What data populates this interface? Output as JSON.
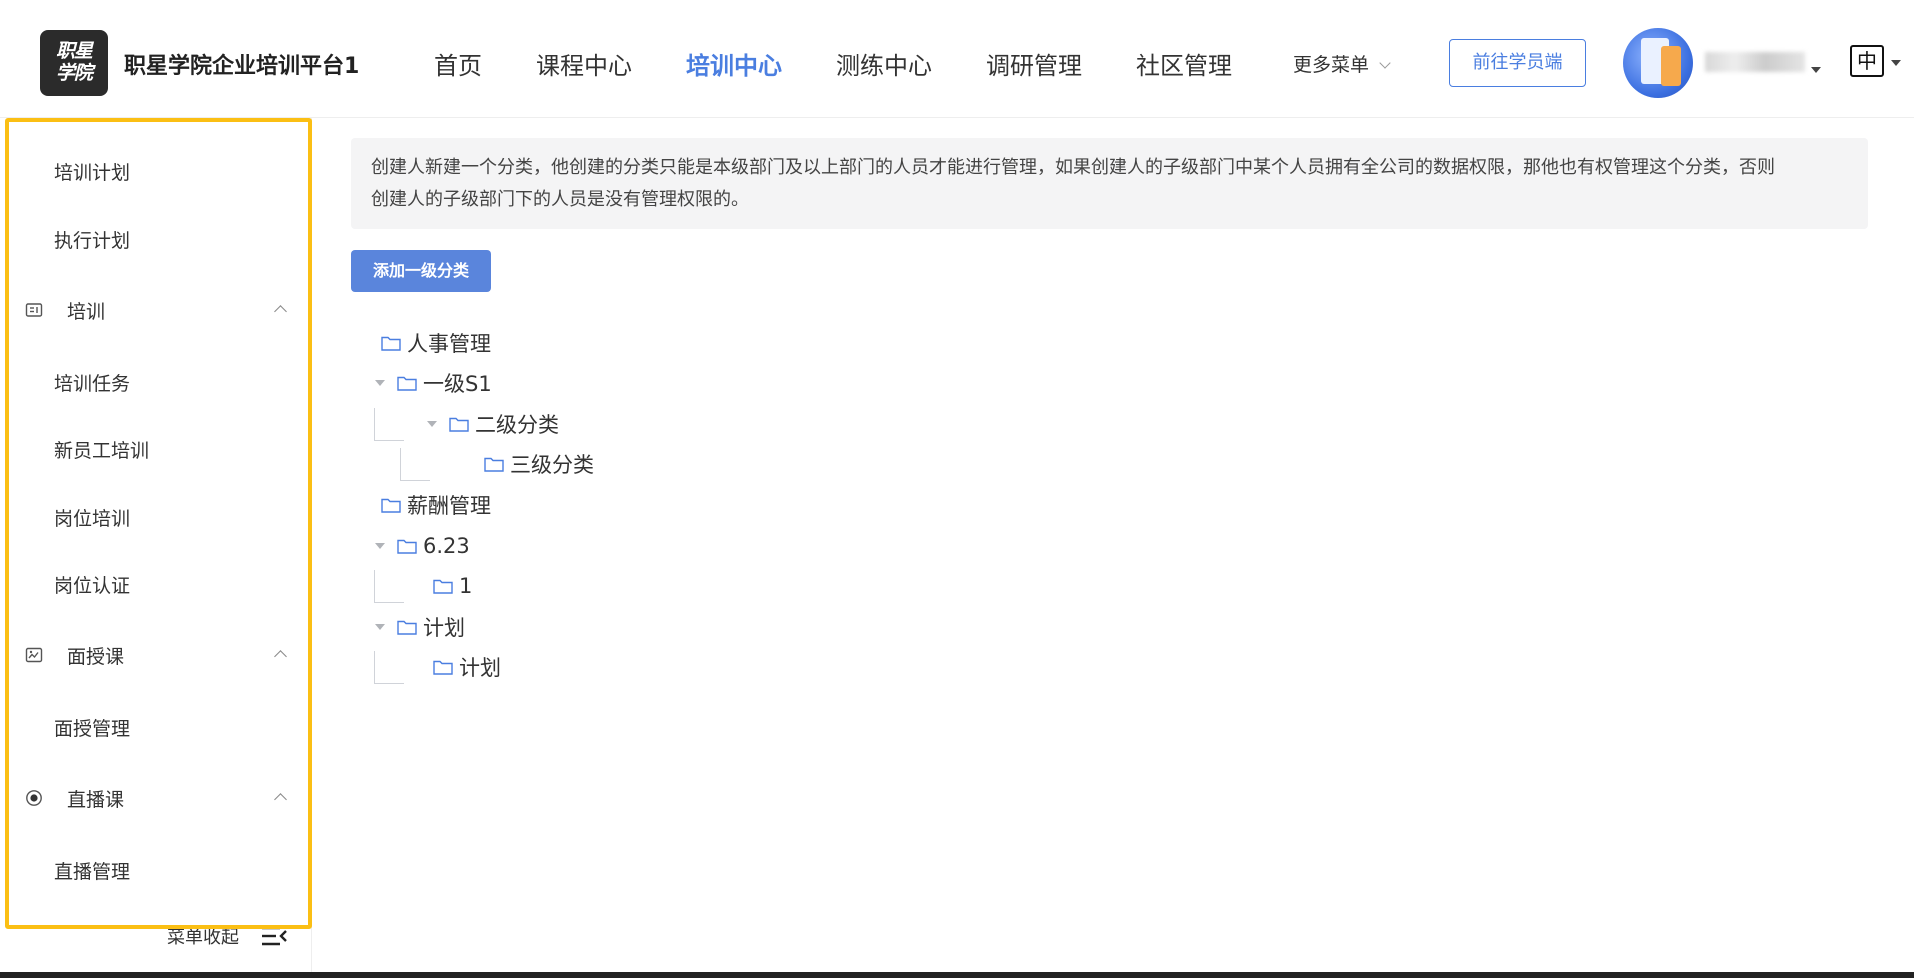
{
  "header": {
    "logo_text": "职星学院",
    "brand": "职星学院企业培训平台1",
    "nav": [
      {
        "label": "首页",
        "active": false
      },
      {
        "label": "课程中心",
        "active": false
      },
      {
        "label": "培训中心",
        "active": true
      },
      {
        "label": "测练中心",
        "active": false
      },
      {
        "label": "调研管理",
        "active": false
      },
      {
        "label": "社区管理",
        "active": false
      }
    ],
    "more_menu": "更多菜单",
    "goto_student": "前往学员端",
    "lang": "中"
  },
  "sidebar": {
    "items": [
      {
        "type": "item",
        "label": "培训计划"
      },
      {
        "type": "item",
        "label": "执行计划"
      },
      {
        "type": "group",
        "label": "培训",
        "icon": "training-icon"
      },
      {
        "type": "item",
        "label": "培训任务"
      },
      {
        "type": "item",
        "label": "新员工培训"
      },
      {
        "type": "item",
        "label": "岗位培训"
      },
      {
        "type": "item",
        "label": "岗位认证"
      },
      {
        "type": "group",
        "label": "面授课",
        "icon": "face-to-face-icon"
      },
      {
        "type": "item",
        "label": "面授管理"
      },
      {
        "type": "group",
        "label": "直播课",
        "icon": "live-icon"
      },
      {
        "type": "item",
        "label": "直播管理"
      }
    ],
    "collapse_label": "菜单收起"
  },
  "main": {
    "notice_line1": "创建人新建一个分类，他创建的分类只能是本级部门及以上部门的人员才能进行管理，如果创建人的子级部门中某个人员拥有全公司的数据权限，那他也有权管理这个分类，否则",
    "notice_line2": "创建人的子级部门下的人员是没有管理权限的。",
    "add_button": "添加一级分类",
    "tree": [
      {
        "label": "人事管理",
        "level": 0,
        "expandable": false
      },
      {
        "label": "一级S1",
        "level": 0,
        "expandable": true
      },
      {
        "label": "二级分类",
        "level": 1,
        "expandable": true
      },
      {
        "label": "三级分类",
        "level": 2,
        "expandable": false
      },
      {
        "label": "薪酬管理",
        "level": 0,
        "expandable": false
      },
      {
        "label": "6.23",
        "level": 0,
        "expandable": true
      },
      {
        "label": "1",
        "level": 1,
        "expandable": false
      },
      {
        "label": "计划",
        "level": 0,
        "expandable": true
      },
      {
        "label": "计划",
        "level": 1,
        "expandable": false
      }
    ]
  },
  "colors": {
    "accent": "#4a7ee0",
    "button_bg": "#5a85dc",
    "highlight_border": "#fbbf14",
    "notice_bg": "#f4f4f5"
  }
}
